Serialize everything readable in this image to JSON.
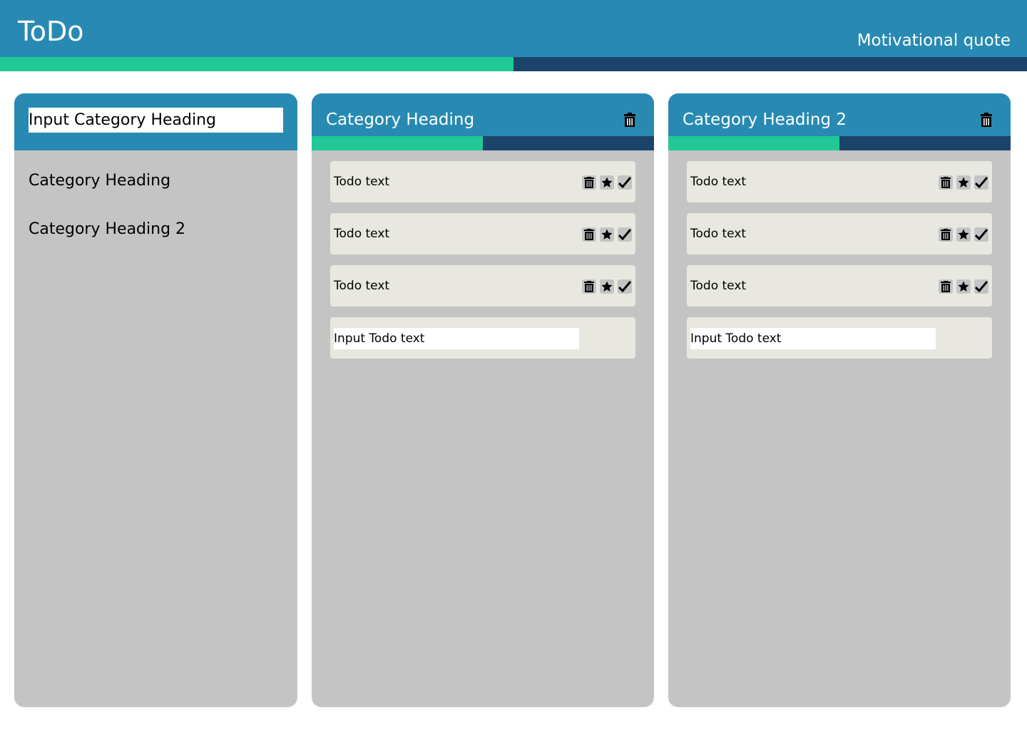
{
  "app": {
    "title": "ToDo",
    "quote": "Motivational quote",
    "progress": 0.5
  },
  "sidebar": {
    "input_placeholder": "Input Category Heading",
    "items": [
      {
        "label": "Category Heading"
      },
      {
        "label": "Category Heading 2"
      }
    ]
  },
  "categories": [
    {
      "title": "Category Heading",
      "progress": 0.5,
      "todos": [
        {
          "text": "Todo text"
        },
        {
          "text": "Todo text"
        },
        {
          "text": "Todo text"
        }
      ],
      "input_placeholder": "Input Todo text"
    },
    {
      "title": "Category Heading 2",
      "progress": 0.5,
      "todos": [
        {
          "text": "Todo text"
        },
        {
          "text": "Todo text"
        },
        {
          "text": "Todo text"
        }
      ],
      "input_placeholder": "Input Todo text"
    }
  ],
  "colors": {
    "header": "#288ab2",
    "progress_fill": "#20c996",
    "progress_track": "#1c446b",
    "panel": "#c4c4c4",
    "todo_card": "#e8e8e0"
  },
  "icons": [
    "trash-icon",
    "star-icon",
    "check-icon"
  ]
}
